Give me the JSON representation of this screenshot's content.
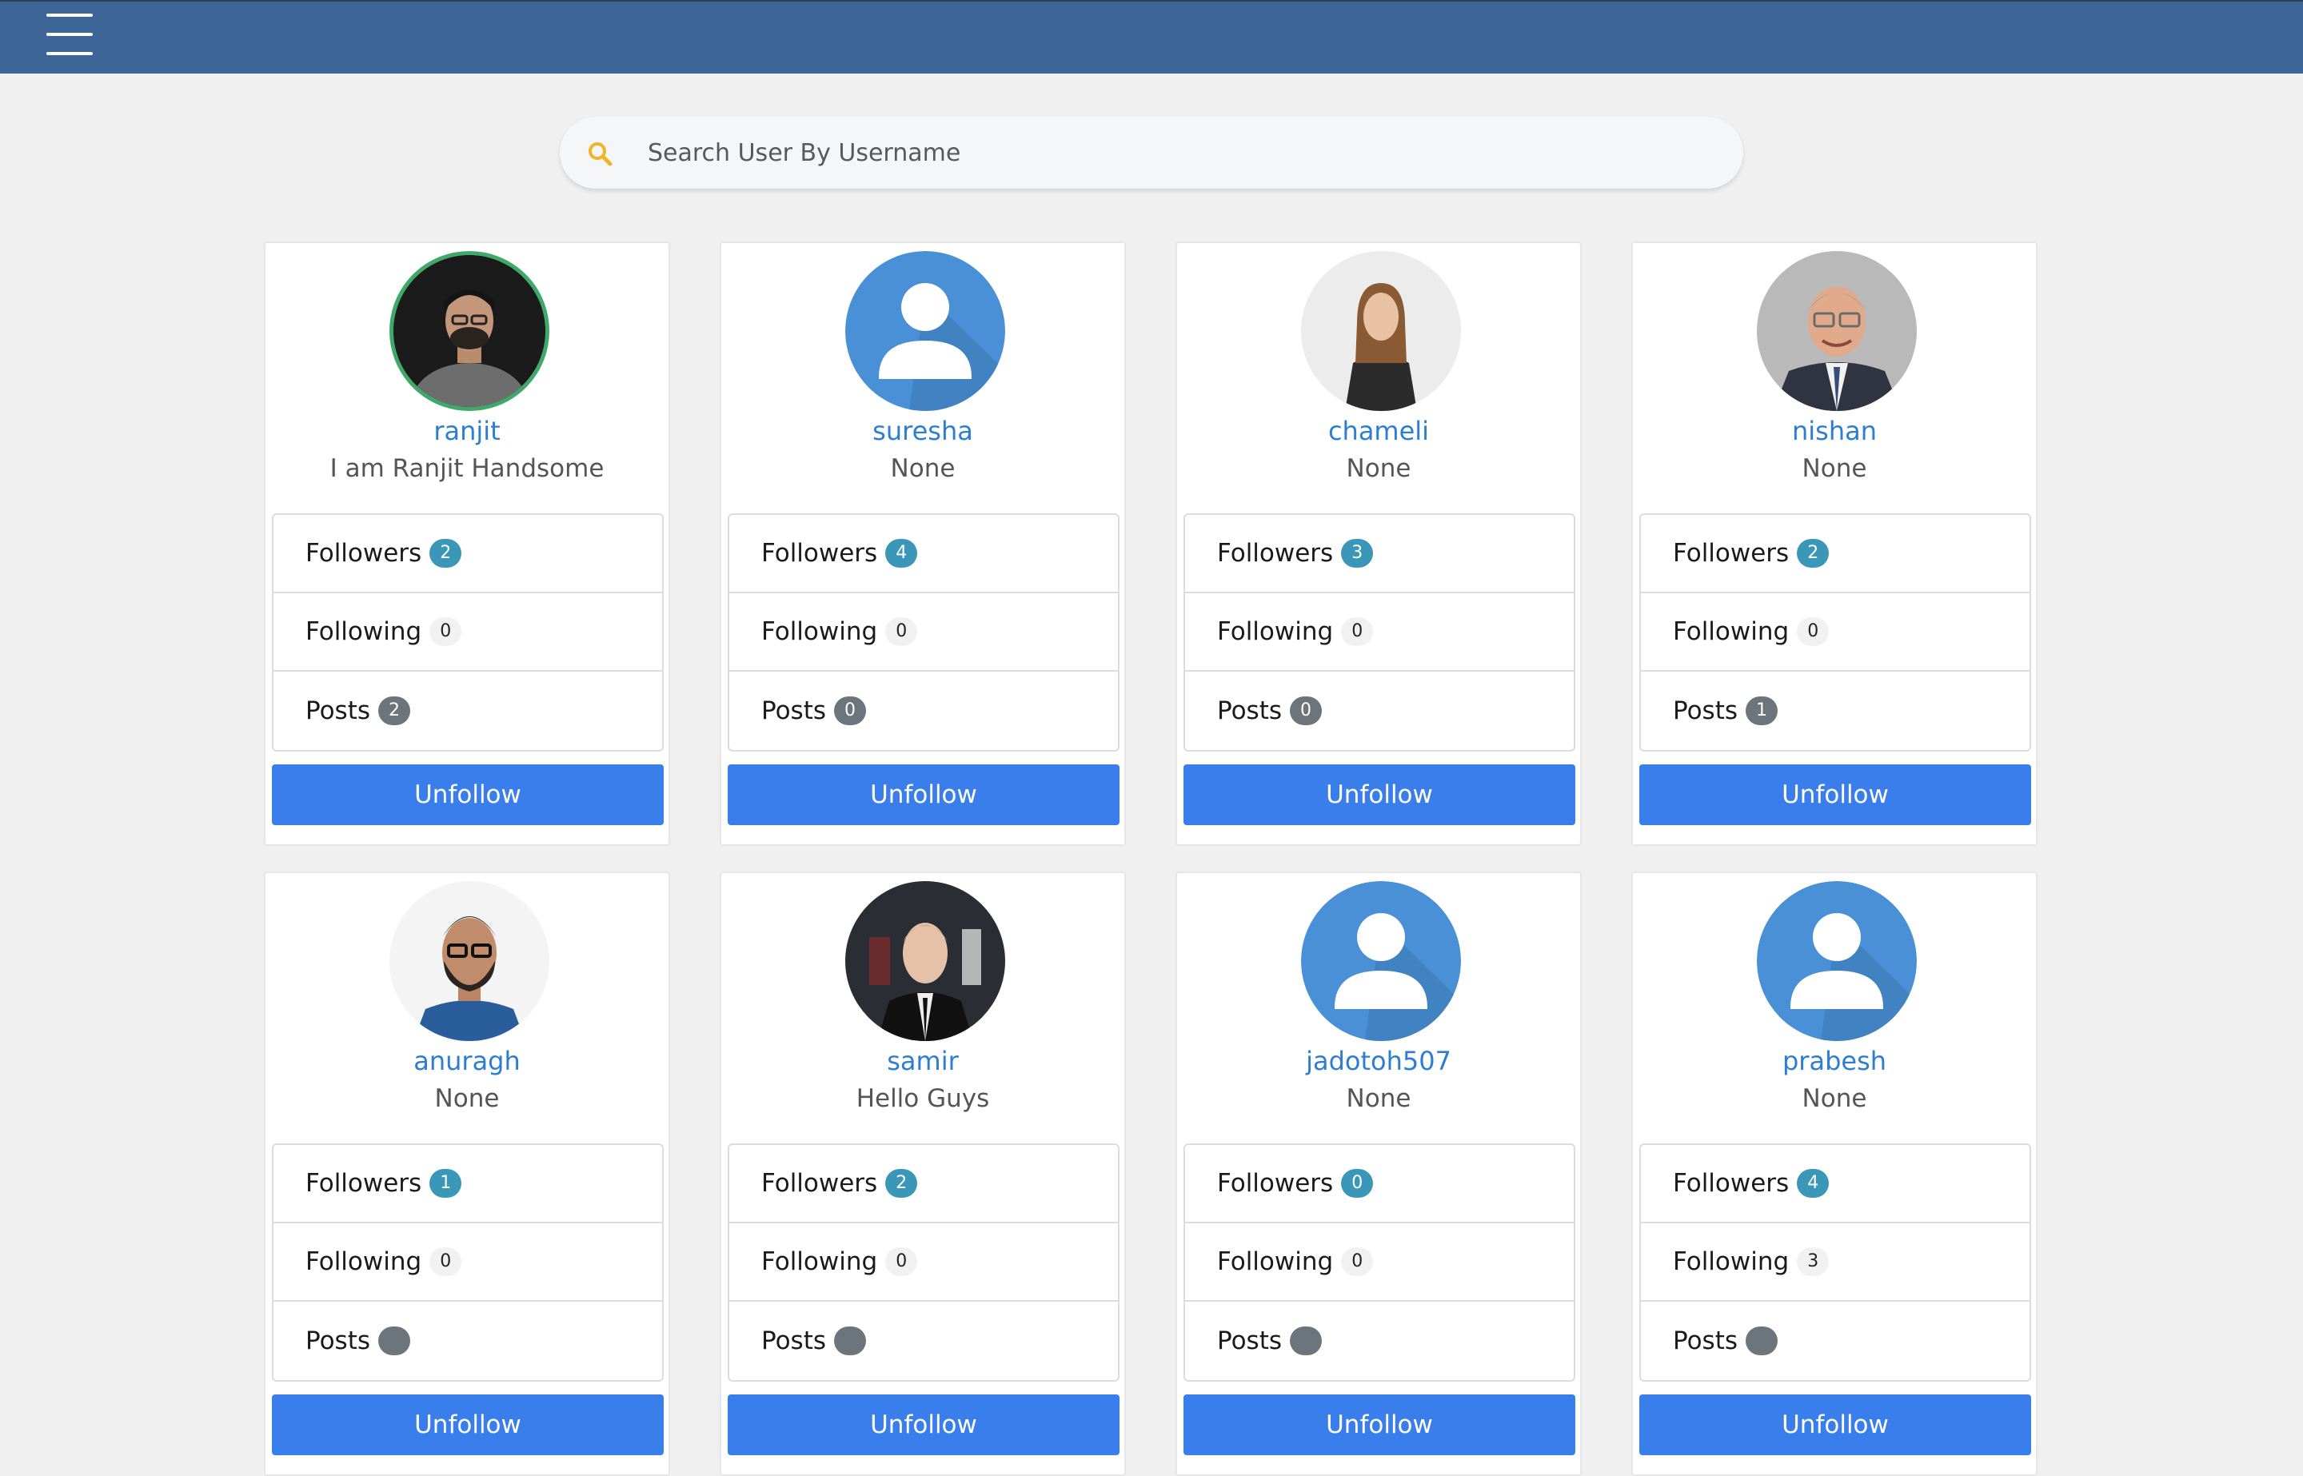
{
  "search": {
    "placeholder": "Search User By Username",
    "icon": "search-icon",
    "icon_color": "#f0b429"
  },
  "colors": {
    "navbar": "#3e6597",
    "username_link": "#2d7dd2",
    "button": "#3a7eeb",
    "followers_badge": "#3a97b8",
    "posts_badge": "#6c747c",
    "avatar_ring": "#3fa96a"
  },
  "labels": {
    "followers": "Followers",
    "following": "Following",
    "posts": "Posts",
    "action": "Unfollow"
  },
  "users": [
    {
      "username": "ranjit",
      "bio": "I am Ranjit Handsome",
      "followers": "2",
      "following": "0",
      "posts": "2",
      "avatar": "photo",
      "ring": true
    },
    {
      "username": "suresha",
      "bio": "None",
      "followers": "4",
      "following": "0",
      "posts": "0",
      "avatar": "default-user-icon",
      "ring": false
    },
    {
      "username": "chameli",
      "bio": "None",
      "followers": "3",
      "following": "0",
      "posts": "0",
      "avatar": "photo",
      "ring": false
    },
    {
      "username": "nishan",
      "bio": "None",
      "followers": "2",
      "following": "0",
      "posts": "1",
      "avatar": "photo",
      "ring": false
    },
    {
      "username": "anuragh",
      "bio": "None",
      "followers": "1",
      "following": "0",
      "posts": null,
      "avatar": "photo",
      "ring": false
    },
    {
      "username": "samir",
      "bio": "Hello Guys",
      "followers": "2",
      "following": "0",
      "posts": null,
      "avatar": "photo",
      "ring": false
    },
    {
      "username": "jadotoh507",
      "bio": "None",
      "followers": "0",
      "following": "0",
      "posts": null,
      "avatar": "default-user-icon",
      "ring": false
    },
    {
      "username": "prabesh",
      "bio": "None",
      "followers": "4",
      "following": "3",
      "posts": null,
      "avatar": "default-user-icon",
      "ring": false
    }
  ]
}
